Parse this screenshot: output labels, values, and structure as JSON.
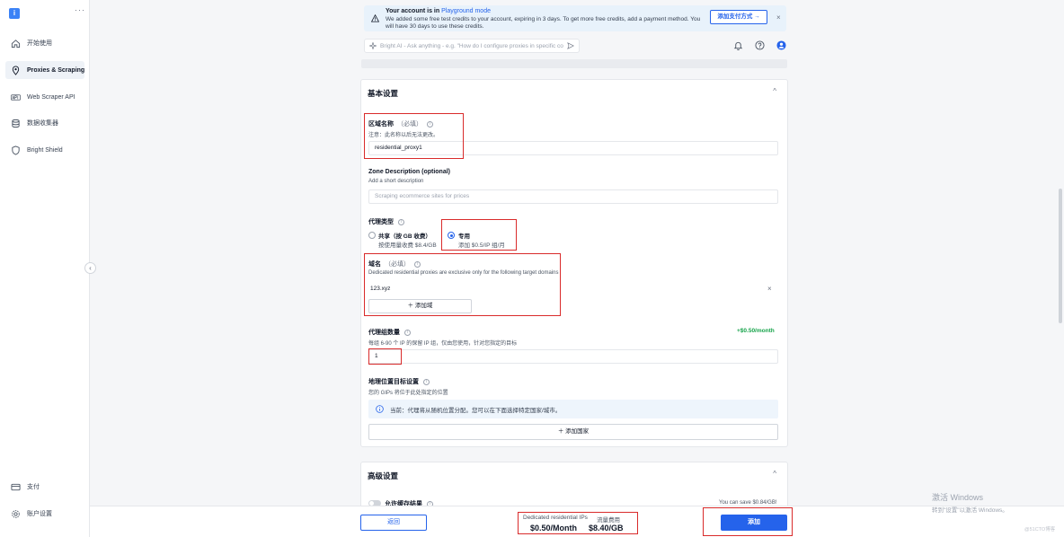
{
  "sidebar": {
    "logo": "i",
    "more": "···",
    "items": [
      {
        "label": "开始使用",
        "icon": "home-icon"
      },
      {
        "label": "Proxies & Scraping",
        "icon": "location-pin-icon"
      },
      {
        "label": "Web Scraper API",
        "icon": "api-icon"
      },
      {
        "label": "数据收集器",
        "icon": "database-icon"
      },
      {
        "label": "Bright Shield",
        "icon": "shield-icon"
      }
    ],
    "bottom_items": [
      {
        "label": "支付",
        "icon": "credit-card-icon"
      },
      {
        "label": "账户设置",
        "icon": "gear-icon"
      }
    ],
    "collapse": "‹"
  },
  "banner": {
    "title_prefix": "Your account is in ",
    "title_link": "Playground mode",
    "text": "We added some free test credits to your account, expiring in 3 days. To get more free credits, add a payment method. You will have 30 days to use these credits.",
    "button": "添加支付方式 →",
    "close": "×"
  },
  "ask": {
    "placeholder": "Bright AI - Ask anything - e.g. \"How do I configure proxies in specific co"
  },
  "basic": {
    "title": "基本设置",
    "caret": "^",
    "zone_name": {
      "label": "区域名称",
      "required": "（必填）",
      "note": "注意：此名称以后无法更改。",
      "value": "residential_proxy1"
    },
    "zone_desc": {
      "label": "Zone Description (optional)",
      "sub": "Add a short description",
      "placeholder": "Scraping ecommerce sites for prices"
    },
    "proxy_type": {
      "label": "代理类型",
      "options": [
        {
          "title": "共享（按 GB 收费）",
          "sub": "按使用量收费 $8.4/GB",
          "checked": false
        },
        {
          "title": "专用",
          "sub": "添加 $0.5/IP 组/月",
          "checked": true
        }
      ]
    },
    "domain": {
      "label": "域名",
      "required": "（必填）",
      "sub": "Dedicated residential proxies are exclusive only for the following target domains",
      "value": "123.xyz",
      "remove": "×",
      "add_button": "＋ 添加域"
    },
    "ip_groups": {
      "label": "代理组数量",
      "price": "+$0.50/month",
      "sub": "每组 6-90 个 IP 的保留 IP 组，仅由您使用，针对您指定的目标",
      "value": "1"
    },
    "geo": {
      "label": "地理位置目标设置",
      "sub": "您的 GIPs 将位于此处指定的位置",
      "notice": "当前：代理将从随机位置分配。您可以在下面选择特定国家/城市。",
      "add_button": "＋ 添加国家"
    }
  },
  "advanced": {
    "title": "高级设置",
    "caret": "^",
    "cache_label": "允许缓存结果",
    "save_note": "You can save $0.84/GB!"
  },
  "bottom": {
    "back": "返回",
    "ip_label": "Dedicated residential IPs",
    "ip_price": "$0.50/Month",
    "traffic_label": "流量费用",
    "traffic_price": "$8.40/GB",
    "add": "添加"
  },
  "watermark": {
    "line1": "激活 Windows",
    "line2": "转到\"设置\"以激活 Windows。",
    "credit": "@51CTO博客"
  },
  "colors": {
    "accent": "#2563eb",
    "highlight_box": "#d92b2b",
    "price_green": "#16a34a"
  }
}
